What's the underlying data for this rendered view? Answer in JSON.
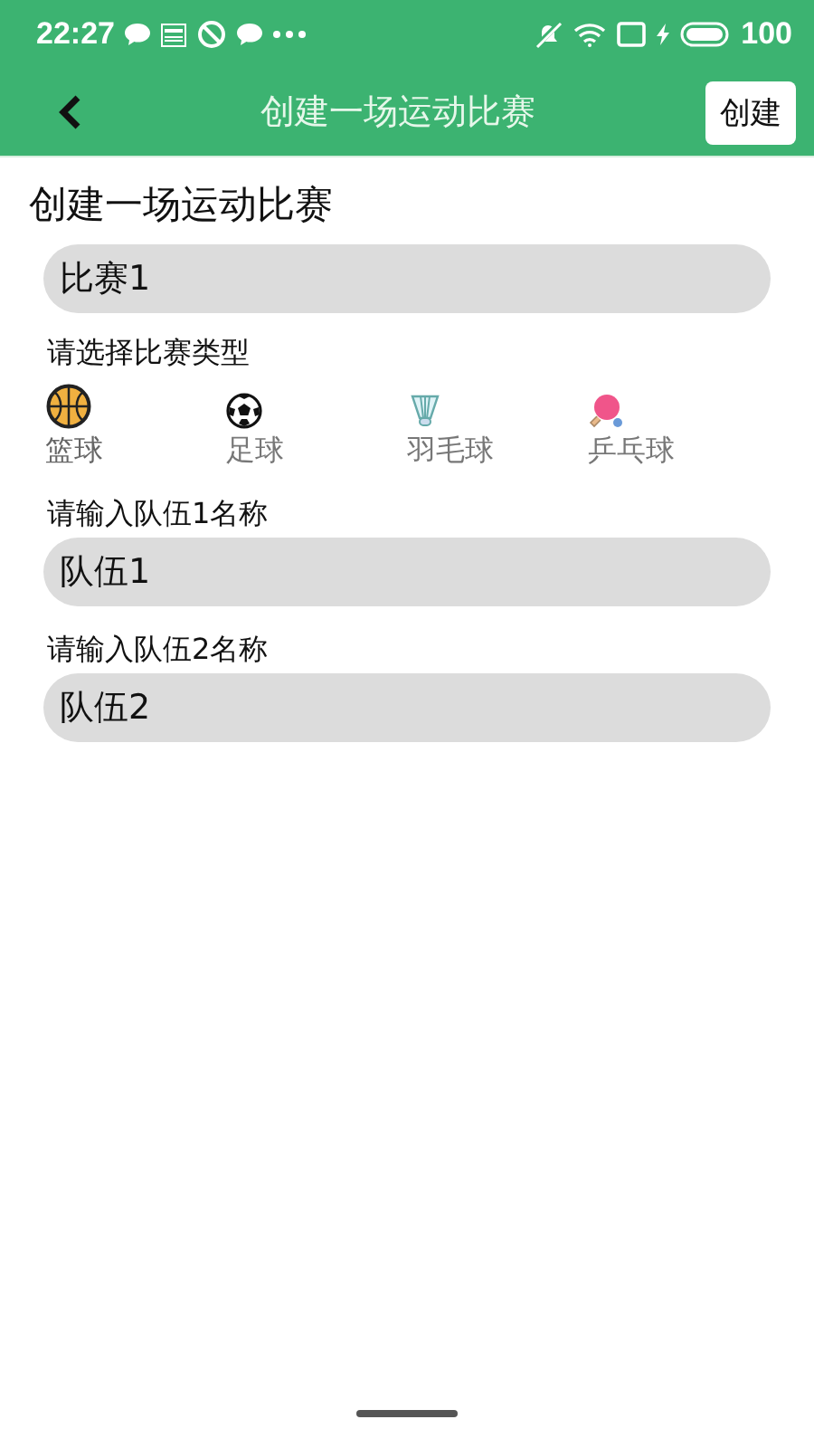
{
  "status_bar": {
    "time": "22:27",
    "battery": "100"
  },
  "header": {
    "title": "创建一场运动比赛",
    "action": "创建"
  },
  "page_title": "创建一场运动比赛",
  "match_name": {
    "value": "比赛1"
  },
  "sport_label": "请选择比赛类型",
  "sports": [
    {
      "kind": "basketball",
      "label": "篮球",
      "selected": true
    },
    {
      "kind": "football",
      "label": "足球",
      "selected": false
    },
    {
      "kind": "badminton",
      "label": "羽毛球",
      "selected": false
    },
    {
      "kind": "pingpong",
      "label": "乒乓球",
      "selected": false
    }
  ],
  "teams": [
    {
      "label": "请输入队伍1名称",
      "value": "队伍1"
    },
    {
      "label": "请输入队伍2名称",
      "value": "队伍2"
    }
  ]
}
